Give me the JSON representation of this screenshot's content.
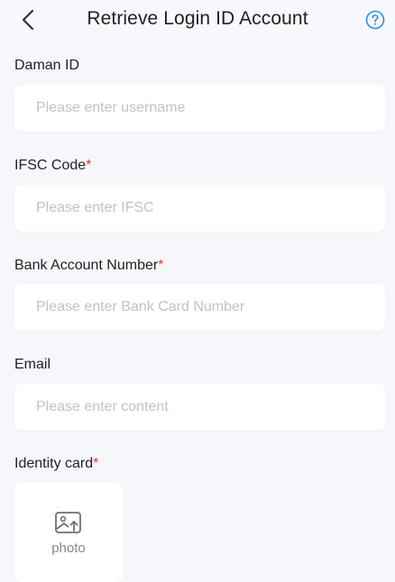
{
  "header": {
    "title": "Retrieve Login ID Account",
    "back_icon": "chevron-left-icon",
    "help_icon": "question-circle-icon",
    "accent_color": "#2b8ef0"
  },
  "fields": [
    {
      "label": "Daman ID",
      "required": false,
      "placeholder": "Please enter username",
      "value": ""
    },
    {
      "label": "IFSC Code",
      "required": true,
      "placeholder": "Please enter IFSC",
      "value": ""
    },
    {
      "label": "Bank Account Number",
      "required": true,
      "placeholder": "Please enter Bank Card Number",
      "value": ""
    },
    {
      "label": "Email",
      "required": false,
      "placeholder": "Please enter content",
      "value": ""
    }
  ],
  "identity": {
    "label": "Identity card",
    "required": true,
    "upload_text": "photo",
    "upload_icon": "image-upload-icon"
  },
  "required_marker": "*",
  "required_color": "#e53935"
}
